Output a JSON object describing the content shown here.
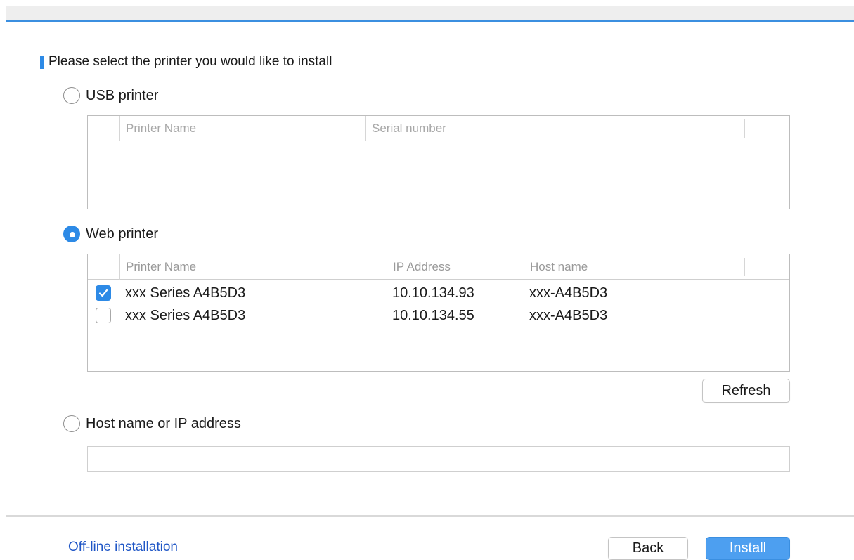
{
  "header": {
    "title": "Please select the printer you would like to install"
  },
  "usb": {
    "label": "USB printer",
    "selected": false,
    "columns": [
      "Printer Name",
      "Serial number"
    ],
    "rows": []
  },
  "web": {
    "label": "Web printer",
    "selected": true,
    "columns": [
      "Printer Name",
      "IP Address",
      "Host name"
    ],
    "rows": [
      {
        "checked": true,
        "name": "xxx Series A4B5D3",
        "ip": "10.10.134.93",
        "host": "xxx-A4B5D3"
      },
      {
        "checked": false,
        "name": "xxx Series A4B5D3",
        "ip": "10.10.134.55",
        "host": "xxx-A4B5D3"
      }
    ],
    "refresh_label": "Refresh"
  },
  "host_option": {
    "label": "Host name or IP address",
    "selected": false,
    "value": "",
    "placeholder": ""
  },
  "footer": {
    "offline_link": "Off-line installation",
    "back_label": "Back",
    "install_label": "Install"
  },
  "colors": {
    "accent": "#2d8ae6",
    "install_button": "#4d9ff0",
    "link": "#1f56c6"
  },
  "icons": {
    "checkbox_check": "checkmark-icon",
    "radio": "radio-dot-icon"
  }
}
